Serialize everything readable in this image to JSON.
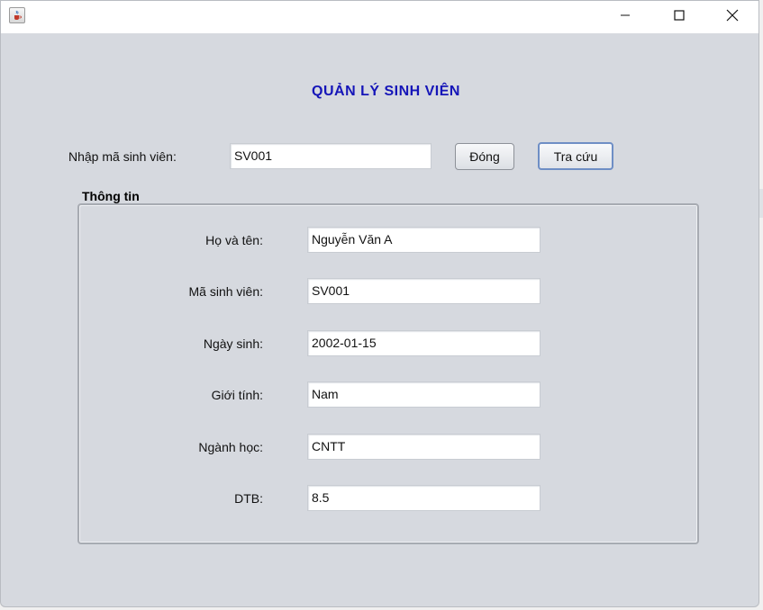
{
  "window": {
    "app_icon": "java-cup-icon",
    "controls": {
      "minimize_icon": "minimize-icon",
      "maximize_icon": "maximize-icon",
      "close_icon": "close-icon"
    }
  },
  "header": {
    "title": "QUẢN LÝ SINH VIÊN"
  },
  "search": {
    "label": "Nhập mã sinh viên:",
    "value": "SV001",
    "close_button": "Đóng",
    "lookup_button": "Tra cứu"
  },
  "info": {
    "group_title": "Thông tin",
    "fields": [
      {
        "label": "Họ và tên:",
        "value": "Nguyễn Văn A"
      },
      {
        "label": "Mã sinh viên:",
        "value": "SV001"
      },
      {
        "label": "Ngày sinh:",
        "value": "2002-01-15"
      },
      {
        "label": "Giới tính:",
        "value": "Nam"
      },
      {
        "label": "Ngành học:",
        "value": "CNTT"
      },
      {
        "label": "DTB:",
        "value": "8.5"
      }
    ]
  }
}
